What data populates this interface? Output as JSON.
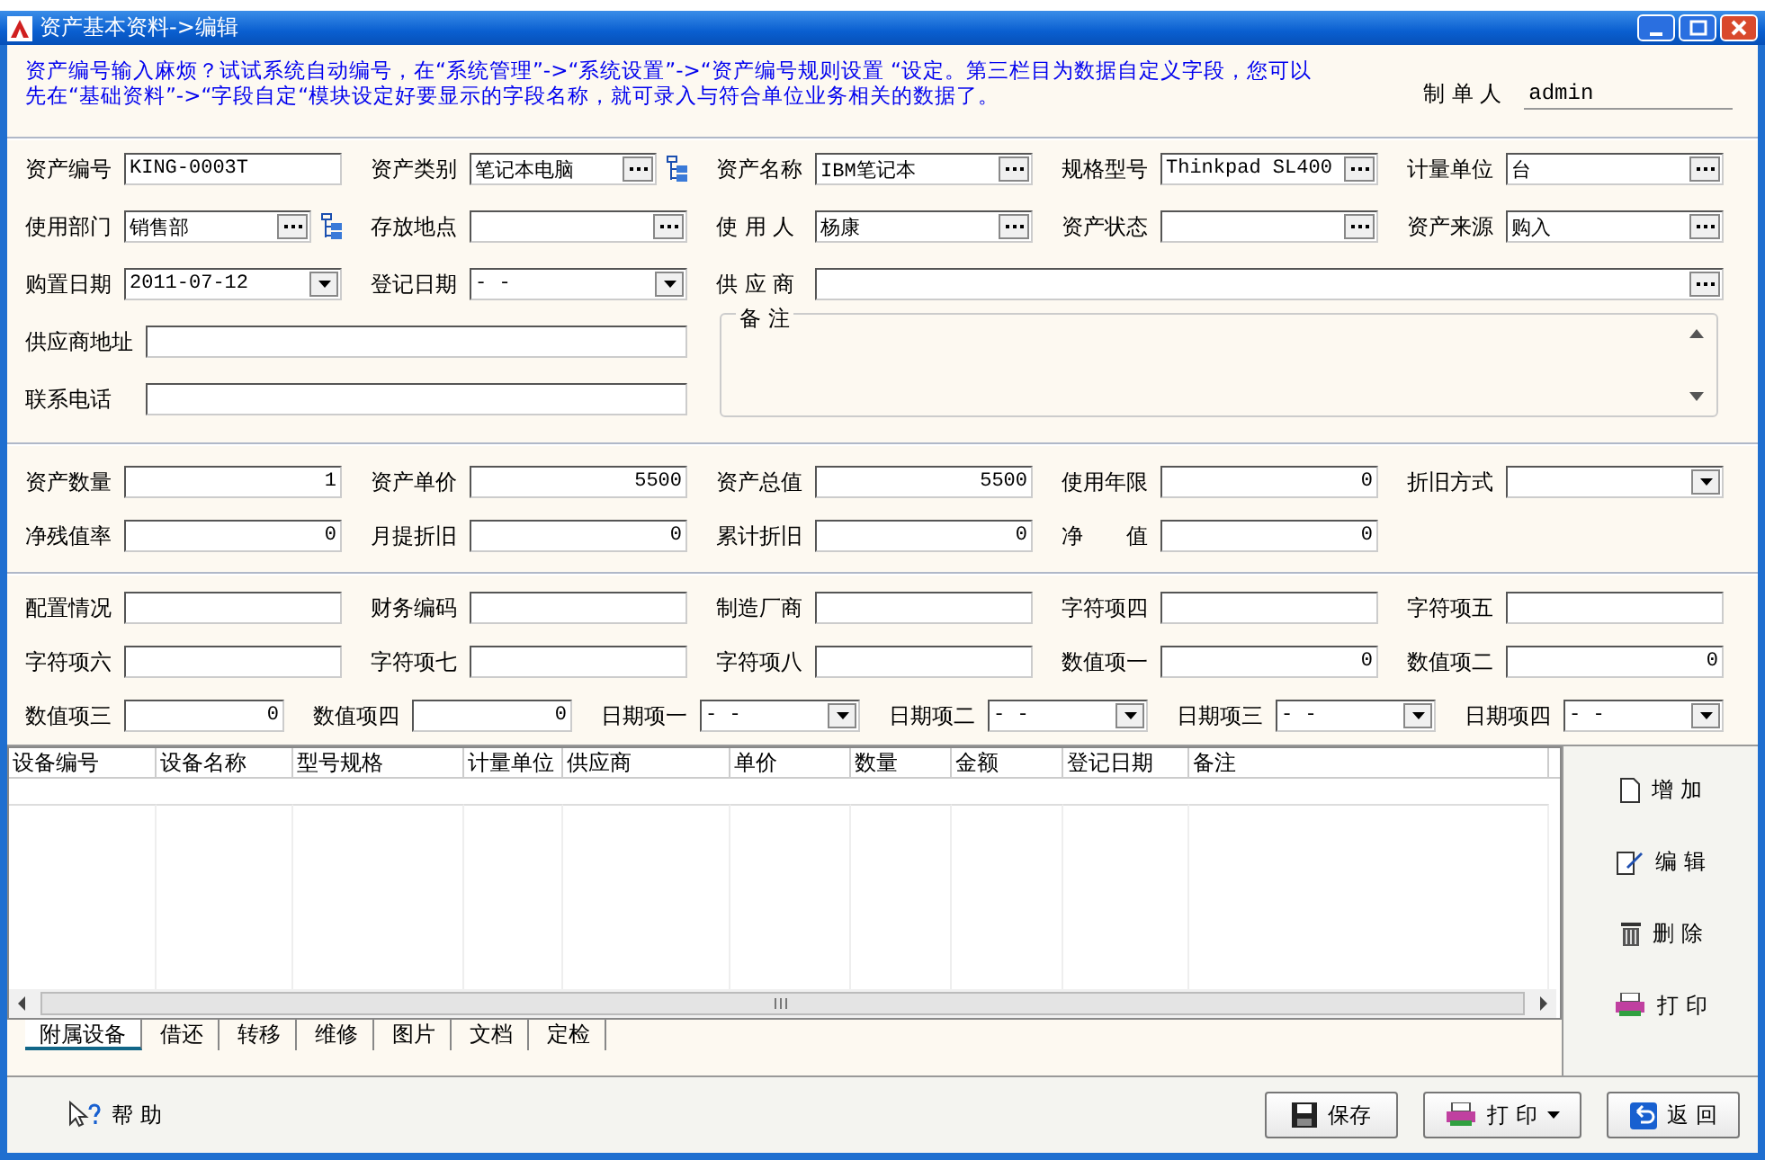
{
  "window": {
    "title": "资产基本资料->编辑"
  },
  "notice": {
    "lines": [
      "资产编号输入麻烦？试试系统自动编号，在“系统管理”->“系统设置”->“资产编号规则设置 “设定。第三栏目为数据自定义字段，您可以",
      "先在“基础资料”->“字段自定“模块设定好要显示的字段名称，就可录入与符合单位业务相关的数据了。"
    ]
  },
  "creator": {
    "label": "制 单 人",
    "value": "admin"
  },
  "basic_fields": [
    [
      {
        "label": "资产编号",
        "kind": "text",
        "value": "KING-0003T"
      },
      {
        "label": "资产类别",
        "kind": "lookup-tree",
        "value": "笔记本电脑"
      },
      {
        "label": "资产名称",
        "kind": "lookup",
        "value": "IBM笔记本"
      },
      {
        "label": "规格型号",
        "kind": "lookup",
        "value": "Thinkpad SL400"
      },
      {
        "label": "计量单位",
        "kind": "lookup",
        "value": "台"
      }
    ],
    [
      {
        "label": "使用部门",
        "kind": "lookup-tree",
        "value": "销售部"
      },
      {
        "label": "存放地点",
        "kind": "lookup"
      },
      {
        "label": "使 用 人",
        "kind": "lookup",
        "value": "杨康"
      },
      {
        "label": "资产状态",
        "kind": "lookup"
      },
      {
        "label": "资产来源",
        "kind": "lookup",
        "value": "购入"
      }
    ],
    [
      {
        "label": "购置日期",
        "kind": "date",
        "value": "2011-07-12"
      },
      {
        "label": "登记日期",
        "kind": "date",
        "value": "-  -"
      },
      {
        "label": "供 应 商",
        "kind": "lookup"
      }
    ]
  ],
  "contact_fields": [
    {
      "label": "供应商地址"
    },
    {
      "label": "联系电话"
    }
  ],
  "notes": {
    "label": "备 注"
  },
  "value_fields": [
    [
      {
        "label": "资产数量",
        "kind": "number",
        "value": "1"
      },
      {
        "label": "资产单价",
        "kind": "number",
        "value": "5500"
      },
      {
        "label": "资产总值",
        "kind": "number",
        "value": "5500"
      },
      {
        "label": "使用年限",
        "kind": "number",
        "value": "0"
      },
      {
        "label": "折旧方式",
        "kind": "date"
      }
    ],
    [
      {
        "label": "净残值率",
        "kind": "number",
        "value": "0"
      },
      {
        "label": "月提折旧",
        "kind": "number",
        "value": "0"
      },
      {
        "label": "累计折旧",
        "kind": "number",
        "value": "0"
      },
      {
        "label": "净　　值",
        "kind": "number",
        "value": "0"
      }
    ]
  ],
  "custom_fields": [
    [
      {
        "label": "配置情况",
        "kind": "text"
      },
      {
        "label": "财务编码",
        "kind": "text"
      },
      {
        "label": "制造厂商",
        "kind": "text"
      },
      {
        "label": "字符项四",
        "kind": "text"
      },
      {
        "label": "字符项五",
        "kind": "text"
      }
    ],
    [
      {
        "label": "字符项六",
        "kind": "text"
      },
      {
        "label": "字符项七",
        "kind": "text"
      },
      {
        "label": "字符项八",
        "kind": "text"
      },
      {
        "label": "数值项一",
        "kind": "number",
        "value": "0"
      },
      {
        "label": "数值项二",
        "kind": "number",
        "value": "0"
      }
    ],
    [
      {
        "label": "数值项三",
        "kind": "number",
        "value": "0"
      },
      {
        "label": "数值项四",
        "kind": "number",
        "value": "0"
      },
      {
        "label": "日期项一",
        "kind": "date",
        "value": "-  -"
      },
      {
        "label": "日期项二",
        "kind": "date",
        "value": "-  -"
      },
      {
        "label": "日期项三",
        "kind": "date",
        "value": "-  -"
      },
      {
        "label": "日期项四",
        "kind": "date",
        "value": "-  -"
      }
    ]
  ],
  "table": {
    "columns": [
      "设备编号",
      "设备名称",
      "型号规格",
      "计量单位",
      "供应商",
      "单价",
      "数量",
      "金额",
      "登记日期",
      "备注"
    ]
  },
  "tabs": [
    {
      "label": "附属设备",
      "selected": true
    },
    {
      "label": "借还",
      "selected": false
    },
    {
      "label": "转移",
      "selected": false
    },
    {
      "label": "维修",
      "selected": false
    },
    {
      "label": "图片",
      "selected": false
    },
    {
      "label": "文档",
      "selected": false
    },
    {
      "label": "定检",
      "selected": false
    }
  ],
  "side_buttons": [
    {
      "kind": "add",
      "label": "增 加"
    },
    {
      "kind": "edit",
      "label": "编 辑"
    },
    {
      "kind": "delete",
      "label": "删 除"
    },
    {
      "kind": "print",
      "label": "打 印"
    }
  ],
  "help": {
    "label": "帮 助"
  },
  "footer_buttons": [
    {
      "kind": "save",
      "label": "保存"
    },
    {
      "kind": "print",
      "label": "打 印"
    },
    {
      "kind": "back",
      "label": "返 回"
    }
  ]
}
